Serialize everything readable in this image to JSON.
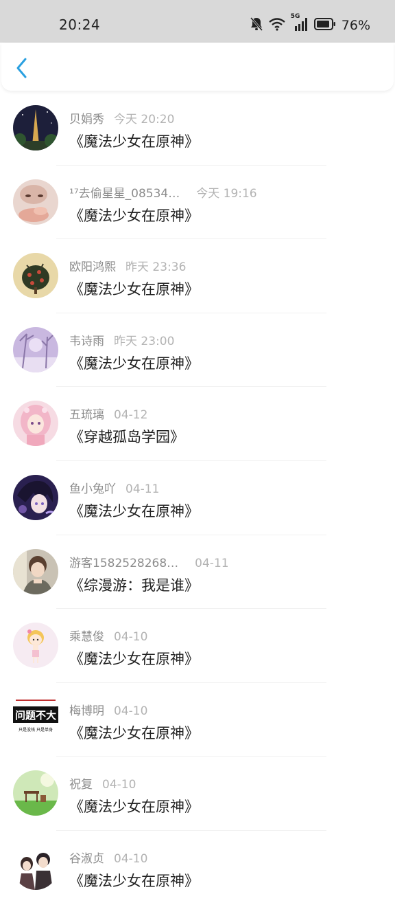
{
  "status_bar": {
    "time": "20:24",
    "battery": "76%",
    "network": "5G",
    "icons": [
      "bell-muted-icon",
      "wifi-icon",
      "signal-icon",
      "battery-icon"
    ]
  },
  "nav": {
    "back_icon": "chevron-left-icon"
  },
  "colors": {
    "accent": "#2aa0e0",
    "status_bar_bg": "#d9d9d9",
    "name_text": "#8c8c8c",
    "time_text": "#b3b3b3",
    "title_text": "#222222"
  },
  "comments": [
    {
      "name": "贝娟秀",
      "time": "今天 20:20",
      "book": "《魔法少女在原神》"
    },
    {
      "name": "¹⁷去偷星星_08534…",
      "time": "今天 19:16",
      "book": "《魔法少女在原神》"
    },
    {
      "name": "欧阳鸿熙",
      "time": "昨天 23:36",
      "book": "《魔法少女在原神》"
    },
    {
      "name": "韦诗雨",
      "time": "昨天 23:00",
      "book": "《魔法少女在原神》"
    },
    {
      "name": "五琉璃",
      "time": "04-12",
      "book": "《穿越孤岛学园》"
    },
    {
      "name": "鱼小兔吖",
      "time": "04-11",
      "book": "《魔法少女在原神》"
    },
    {
      "name": "游客1582528268…",
      "time": "04-11",
      "book": "《综漫游：我是谁》"
    },
    {
      "name": "乘慧俊",
      "time": "04-10",
      "book": "《魔法少女在原神》"
    },
    {
      "name": "梅博明",
      "time": "04-10",
      "book": "《魔法少女在原神》",
      "avatar_text": "问题不大",
      "avatar_subtext": "只是没钱  只是单身"
    },
    {
      "name": "祝复",
      "time": "04-10",
      "book": "《魔法少女在原神》"
    },
    {
      "name": "谷淑贞",
      "time": "04-10",
      "book": "《魔法少女在原神》"
    }
  ]
}
